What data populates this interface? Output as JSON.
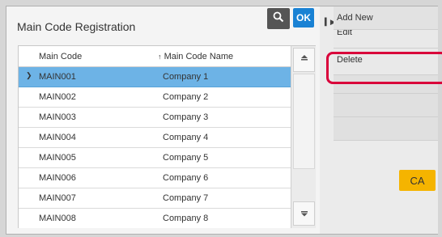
{
  "header": {
    "title": "Main Code Registration",
    "ok_label": "OK"
  },
  "table": {
    "columns": [
      "Main Code",
      "Main Code Name"
    ],
    "rows": [
      {
        "code": "MAIN001",
        "name": "Company 1",
        "selected": true
      },
      {
        "code": "MAIN002",
        "name": "Company 2"
      },
      {
        "code": "MAIN003",
        "name": "Company 3"
      },
      {
        "code": "MAIN004",
        "name": "Company 4"
      },
      {
        "code": "MAIN005",
        "name": "Company 5"
      },
      {
        "code": "MAIN006",
        "name": "Company 6"
      },
      {
        "code": "MAIN007",
        "name": "Company 7"
      },
      {
        "code": "MAIN008",
        "name": "Company 8"
      }
    ]
  },
  "menu": {
    "items": [
      "Add New",
      "Edit",
      "Delete",
      "",
      "",
      ""
    ]
  },
  "ca_label": "CA",
  "icons": {
    "sort_indicator": "up-arrow-icon",
    "search": "search-icon",
    "selected_row": "chevron-down-icon",
    "scroll_up": "double-chevron-up-icon",
    "scroll_down": "double-chevron-down-icon",
    "panel_expand": "play-arrow-icon"
  },
  "colors": {
    "ok_button": "#1a82d4",
    "selected_row": "#6db3e6",
    "highlight": "#d9003a",
    "ca_button": "#f5b400"
  }
}
